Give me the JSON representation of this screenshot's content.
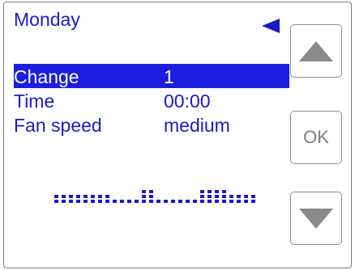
{
  "screen": {
    "title": "Monday"
  },
  "menu": {
    "rows": [
      {
        "label": "Change",
        "value": "1",
        "selected": true
      },
      {
        "label": "Time",
        "value": "00:00",
        "selected": false
      },
      {
        "label": "Fan speed",
        "value": "medium",
        "selected": false
      }
    ]
  },
  "buttons": {
    "up_icon": "triangle-up-icon",
    "ok_label": "OK",
    "down_icon": "triangle-down-icon"
  },
  "schedule": {
    "levels": [
      2,
      2,
      2,
      2,
      2,
      2,
      2,
      2,
      1,
      1,
      1,
      1,
      3,
      3,
      1,
      1,
      1,
      1,
      1,
      1,
      3,
      3,
      3,
      3,
      2,
      2,
      2,
      2
    ]
  },
  "colors": {
    "text": "#1a1acb",
    "selection": "#1d1de0",
    "button_icon": "#8a8a8a"
  }
}
